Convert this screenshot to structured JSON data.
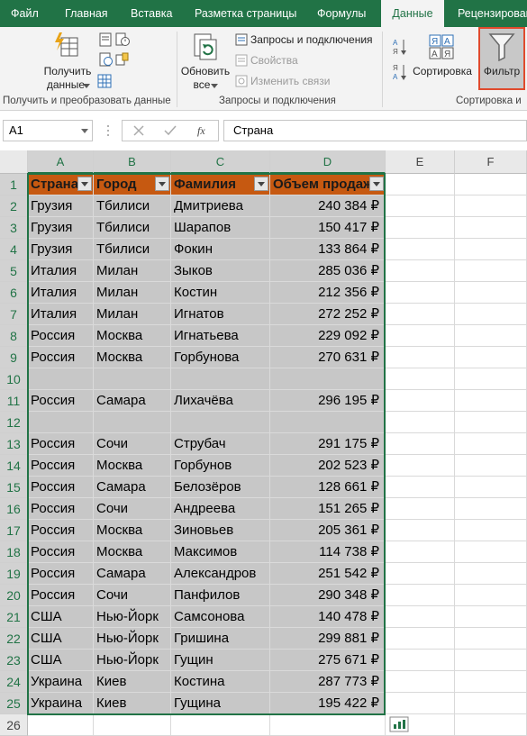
{
  "ribbon_tabs": [
    "Файл",
    "Главная",
    "Вставка",
    "Разметка страницы",
    "Формулы",
    "Данные",
    "Рецензирован"
  ],
  "ribbon": {
    "get_data_line1": "Получить",
    "get_data_line2": "данные",
    "refresh_line1": "Обновить",
    "refresh_line2": "все",
    "queries": "Запросы и подключения",
    "properties": "Свойства",
    "edit_links": "Изменить связи",
    "sort": "Сортировка",
    "filter": "Фильтр",
    "group_get": "Получить и преобразовать данные",
    "group_queries": "Запросы и подключения",
    "group_sort": "Сортировка и"
  },
  "name_box": "A1",
  "formula": "Страна",
  "columns": [
    "A",
    "B",
    "C",
    "D",
    "E",
    "F"
  ],
  "headers": [
    "Страна",
    "Город",
    "Фамилия",
    "Объем продаж"
  ],
  "rows": [
    {
      "n": "1"
    },
    {
      "n": "2",
      "a": "Грузия",
      "b": "Тбилиси",
      "c": "Дмитриева",
      "d": "240 384 ₽"
    },
    {
      "n": "3",
      "a": "Грузия",
      "b": "Тбилиси",
      "c": "Шарапов",
      "d": "150 417 ₽"
    },
    {
      "n": "4",
      "a": "Грузия",
      "b": "Тбилиси",
      "c": "Фокин",
      "d": "133 864 ₽"
    },
    {
      "n": "5",
      "a": "Италия",
      "b": "Милан",
      "c": "Зыков",
      "d": "285 036 ₽"
    },
    {
      "n": "6",
      "a": "Италия",
      "b": "Милан",
      "c": "Костин",
      "d": "212 356 ₽"
    },
    {
      "n": "7",
      "a": "Италия",
      "b": "Милан",
      "c": "Игнатов",
      "d": "272 252 ₽"
    },
    {
      "n": "8",
      "a": "Россия",
      "b": "Москва",
      "c": "Игнатьева",
      "d": "229 092 ₽"
    },
    {
      "n": "9",
      "a": "Россия",
      "b": "Москва",
      "c": "Горбунова",
      "d": "270 631 ₽"
    },
    {
      "n": "10",
      "a": "",
      "b": "",
      "c": "",
      "d": ""
    },
    {
      "n": "11",
      "a": "Россия",
      "b": "Самара",
      "c": "Лихачёва",
      "d": "296 195 ₽"
    },
    {
      "n": "12",
      "a": "",
      "b": "",
      "c": "",
      "d": ""
    },
    {
      "n": "13",
      "a": "Россия",
      "b": "Сочи",
      "c": "Струбач",
      "d": "291 175 ₽"
    },
    {
      "n": "14",
      "a": "Россия",
      "b": "Москва",
      "c": "Горбунов",
      "d": "202 523 ₽"
    },
    {
      "n": "15",
      "a": "Россия",
      "b": "Самара",
      "c": "Белозёров",
      "d": "128 661 ₽"
    },
    {
      "n": "16",
      "a": "Россия",
      "b": "Сочи",
      "c": "Андреева",
      "d": "151 265 ₽"
    },
    {
      "n": "17",
      "a": "Россия",
      "b": "Москва",
      "c": "Зиновьев",
      "d": "205 361 ₽"
    },
    {
      "n": "18",
      "a": "Россия",
      "b": "Москва",
      "c": "Максимов",
      "d": "114 738 ₽"
    },
    {
      "n": "19",
      "a": "Россия",
      "b": "Самара",
      "c": "Александров",
      "d": "251 542 ₽"
    },
    {
      "n": "20",
      "a": "Россия",
      "b": "Сочи",
      "c": "Панфилов",
      "d": "290 348 ₽"
    },
    {
      "n": "21",
      "a": "США",
      "b": "Нью-Йорк",
      "c": "Самсонова",
      "d": "140 478 ₽"
    },
    {
      "n": "22",
      "a": "США",
      "b": "Нью-Йорк",
      "c": "Гришина",
      "d": "299 881 ₽"
    },
    {
      "n": "23",
      "a": "США",
      "b": "Нью-Йорк",
      "c": "Гущин",
      "d": "275 671 ₽"
    },
    {
      "n": "24",
      "a": "Украина",
      "b": "Киев",
      "c": "Костина",
      "d": "287 773 ₽"
    },
    {
      "n": "25",
      "a": "Украина",
      "b": "Киев",
      "c": "Гущина",
      "d": "195 422 ₽"
    },
    {
      "n": "26"
    }
  ],
  "colors": {
    "accent": "#217346",
    "header_fill": "#c65911",
    "selection_fill": "#c7c7c7",
    "filter_highlight": "#e04a2d"
  }
}
